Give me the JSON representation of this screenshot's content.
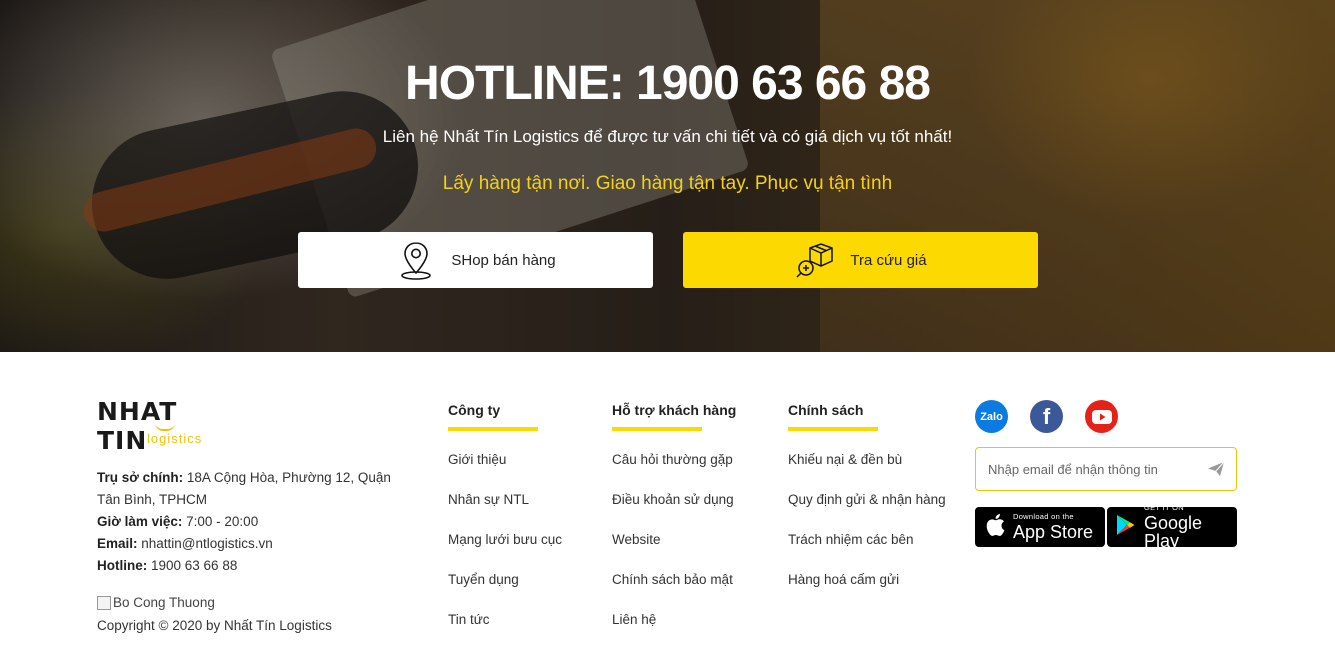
{
  "hero": {
    "hotline": "HOTLINE: 1900 63 66 88",
    "subline": "Liên hệ Nhất Tín Logistics để được tư vấn chi tiết và có giá dịch vụ tốt nhất!",
    "tagline": "Lấy hàng tận nơi. Giao hàng tận tay. Phục vụ tận tình",
    "shop_button": "SHop bán hàng",
    "price_button": "Tra cứu giá",
    "accent": "#fcd900"
  },
  "footer": {
    "logo_word": "NHAT TIN",
    "logo_sub": "logistics",
    "info": {
      "hq_label": "Trụ sở chính:",
      "hq_value": " 18A Cộng Hòa, Phường 12, Quận Tân Bình, TPHCM",
      "hours_label": "Giờ làm việc:",
      "hours_value": " 7:00 - 20:00",
      "email_label": "Email:",
      "email_value": " nhattin@ntlogistics.vn",
      "hotline_label": "Hotline:",
      "hotline_value": " 1900 63 66 88"
    },
    "bct_alt": "Bo Cong Thuong",
    "copyright": "Copyright © 2020 by Nhất Tín Logistics",
    "columns": [
      {
        "title": "Công ty",
        "items": [
          "Giới thiệu",
          "Nhân sự NTL",
          "Mạng lưới bưu cục",
          "Tuyển dụng",
          "Tin tức"
        ]
      },
      {
        "title": "Hỗ trợ khách hàng",
        "items": [
          "Câu hỏi thường gặp",
          "Điều khoản sử dụng",
          "Website",
          "Chính sách bảo mật",
          "Liên hệ"
        ]
      },
      {
        "title": "Chính sách",
        "items": [
          "Khiếu nại & đền bù",
          "Quy định gửi & nhận hàng",
          "Trách nhiệm các bên",
          "Hàng hoá cấm gửi"
        ]
      }
    ],
    "social": {
      "zalo": "Zalo",
      "facebook": "f"
    },
    "email_placeholder": "Nhập email để nhận thông tin",
    "app_store": {
      "small": "Download on the",
      "big": "App Store"
    },
    "google_play": {
      "small": "GET IT ON",
      "big": "Google Play"
    }
  }
}
